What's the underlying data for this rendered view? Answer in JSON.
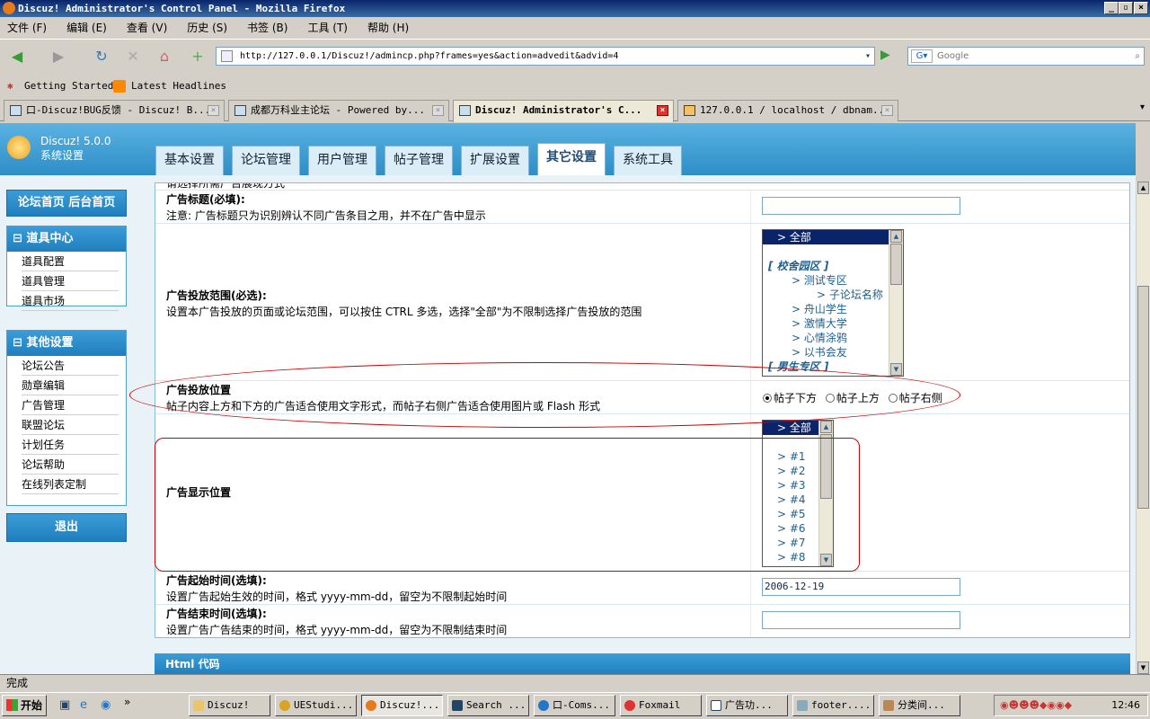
{
  "window": {
    "title": "Discuz! Administrator's Control Panel - Mozilla Firefox"
  },
  "menu": [
    "文件 (F)",
    "编辑 (E)",
    "查看 (V)",
    "历史 (S)",
    "书签 (B)",
    "工具 (T)",
    "帮助 (H)"
  ],
  "address": {
    "url": "http://127.0.0.1/Discuz!/admincp.php?frames=yes&action=advedit&advid=4"
  },
  "search": {
    "placeholder": "Google"
  },
  "bookmarks": [
    "Getting Started",
    "Latest Headlines"
  ],
  "tabs": [
    {
      "label": "口-Discuz!BUG反馈 - Discuz! B..."
    },
    {
      "label": "成都万科业主论坛 - Powered by..."
    },
    {
      "label": "Discuz! Administrator's C..."
    },
    {
      "label": "127.0.0.1 / localhost / dbnam..."
    }
  ],
  "header": {
    "product": "Discuz! 5.0.0",
    "subtitle": "系统设置"
  },
  "main_tabs": [
    "基本设置",
    "论坛管理",
    "用户管理",
    "帖子管理",
    "扩展设置",
    "其它设置",
    "系统工具"
  ],
  "sidebar": {
    "home_links": "论坛首页 后台首页",
    "group1": {
      "title": "道具中心",
      "items": [
        "道具配置",
        "道具管理",
        "道具市场"
      ]
    },
    "group2": {
      "title": "其他设置",
      "items": [
        "论坛公告",
        "勋章编辑",
        "广告管理",
        "联盟论坛",
        "计划任务",
        "论坛帮助",
        "在线列表定制"
      ]
    },
    "logout": "退出"
  },
  "form": {
    "truncated_text": "请选择所需广告展现方式",
    "title_label": "广告标题(必填):",
    "title_desc": "注意: 广告标题只为识别辨认不同广告条目之用，并不在广告中显示",
    "title_value": "",
    "range_label": "广告投放范围(必选):",
    "range_desc": "设置本广告投放的页面或论坛范围，可以按住 CTRL 多选，选择\"全部\"为不限制选择广告投放的范围",
    "range_options": [
      "> 全部",
      "",
      "[ 校舍园区 ]",
      "> 测试专区",
      "> 子论坛名称",
      "> 舟山学生",
      "> 激情大学",
      "> 心情涂鸦",
      "> 以书会友",
      "[ 男生专区 ]"
    ],
    "position_label": "广告投放位置",
    "position_desc": "帖子内容上方和下方的广告适合使用文字形式，而帖子右侧广告适合使用图片或 Flash 形式",
    "position_options": [
      "帖子下方",
      "帖子上方",
      "帖子右侧"
    ],
    "position_selected": "帖子下方",
    "display_label": "广告显示位置",
    "display_options": [
      "> 全部",
      "",
      "> #1",
      "> #2",
      "> #3",
      "> #4",
      "> #5",
      "> #6",
      "> #7",
      "> #8"
    ],
    "start_label": "广告起始时间(选填):",
    "start_desc": "设置广告起始生效的时间，格式 yyyy-mm-dd，留空为不限制起始时间",
    "start_value": "2006-12-19",
    "end_label": "广告结束时间(选填):",
    "end_desc": "设置广告广告结束的时间，格式 yyyy-mm-dd，留空为不限制结束时间",
    "end_value": "",
    "html_section": "Html 代码"
  },
  "status": "完成",
  "taskbar": {
    "start": "开始",
    "tasks": [
      "Discuz!",
      "UEStudi...",
      "Discuz!...",
      "Search ...",
      "口-Coms...",
      "Foxmail",
      "广告功...",
      "footer....",
      "分类间..."
    ],
    "clock": "12:46"
  }
}
